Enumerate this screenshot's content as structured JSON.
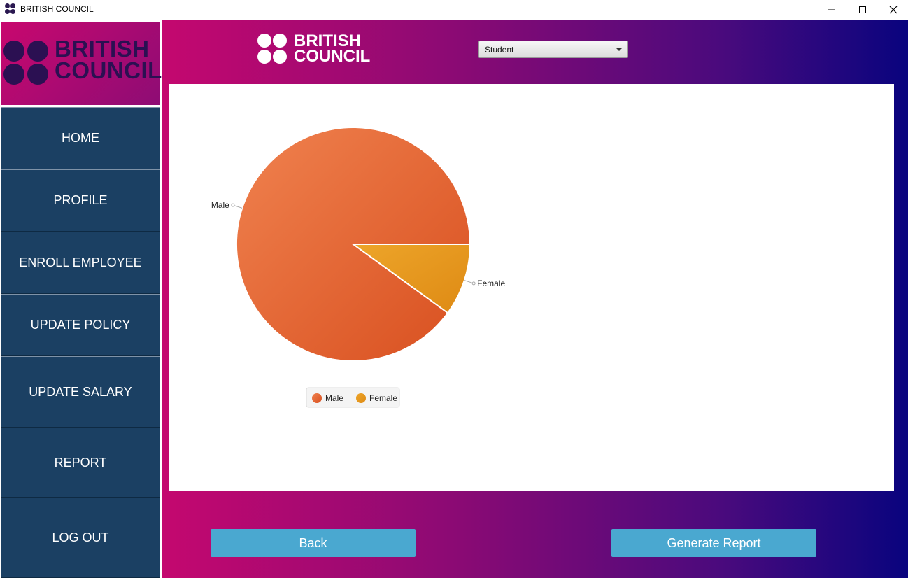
{
  "window": {
    "title": "BRITISH COUNCIL",
    "controls": {
      "minimize": "—",
      "maximize": "☐",
      "close": "✕"
    }
  },
  "sidebar": {
    "logo_line1": "BRITISH",
    "logo_line2": "COUNCIL",
    "logo_color": "#2b1052",
    "items": [
      {
        "label": "HOME"
      },
      {
        "label": "PROFILE"
      },
      {
        "label": "ENROLL EMPLOYEE"
      },
      {
        "label": "UPDATE POLICY"
      },
      {
        "label": "UPDATE SALARY"
      },
      {
        "label": "REPORT"
      },
      {
        "label": "LOG OUT"
      }
    ],
    "item_color": "#1b4063"
  },
  "header": {
    "logo_line1": "BRITISH",
    "logo_line2": "COUNCIL",
    "select_value": "Student"
  },
  "chart_data": {
    "type": "pie",
    "slices": [
      {
        "label": "Male",
        "value": 90,
        "color": "#e05a2b"
      },
      {
        "label": "Female",
        "value": 10,
        "color": "#e6961e"
      }
    ],
    "legend": [
      "Male",
      "Female"
    ],
    "legend_position": "bottom"
  },
  "buttons": {
    "back": "Back",
    "generate": "Generate Report",
    "color": "#4aa8d0"
  }
}
